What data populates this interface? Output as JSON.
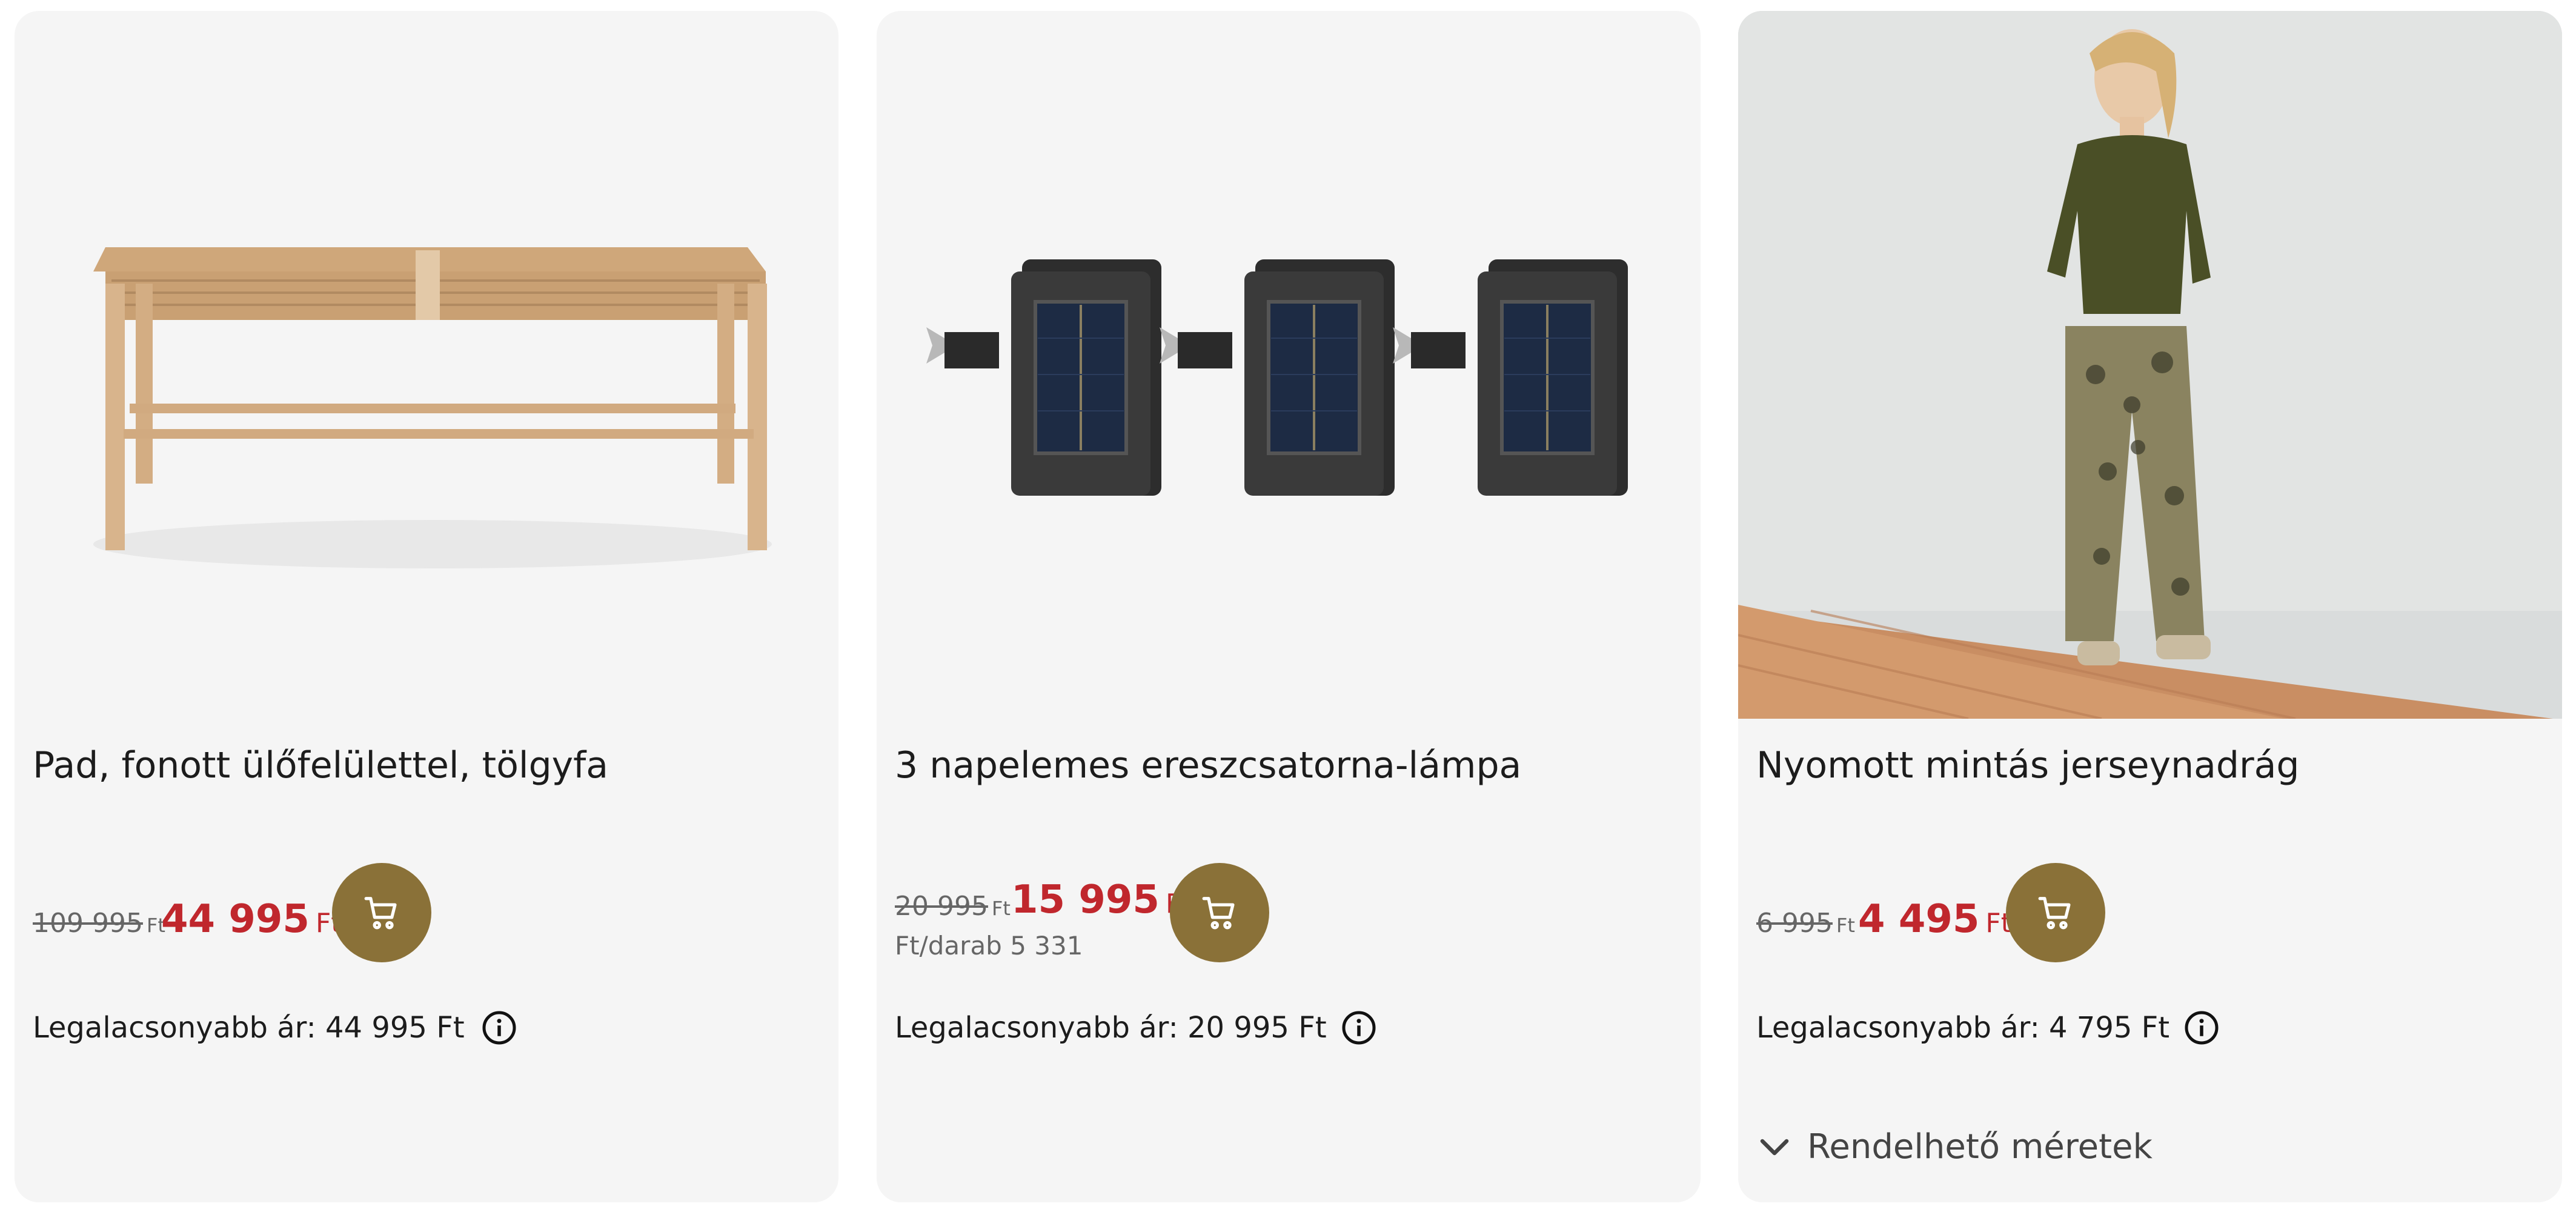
{
  "products": [
    {
      "title": "Pad, fonott ülőfelülettel, tölgyfa",
      "old_price": "109 995",
      "old_currency": "Ft",
      "new_price": "44 995",
      "new_currency": "Ft",
      "lowest_price": "Legalacsonyabb ár: 44 995 Ft"
    },
    {
      "title": "3 napelemes ereszcsatorna-lámpa",
      "old_price": "20 995",
      "old_currency": "Ft",
      "new_price": "15 995",
      "new_currency": "Ft",
      "unit_price": "Ft/darab 5 331",
      "lowest_price": "Legalacsonyabb ár: 20 995 Ft"
    },
    {
      "title": "Nyomott mintás jerseynadrág",
      "old_price": "6 995",
      "old_currency": "Ft",
      "new_price": "4 495",
      "new_currency": "Ft",
      "lowest_price": "Legalacsonyabb ár: 4 795 Ft",
      "sizes_label": "Rendelhető méretek"
    }
  ],
  "icons": {
    "cart": "shopping-cart-icon",
    "info": "info-circle-icon",
    "chevron": "chevron-down-icon"
  },
  "colors": {
    "sale_price": "#c0272d",
    "cart_button": "#8a7138",
    "card_bg": "#f5f5f5"
  }
}
